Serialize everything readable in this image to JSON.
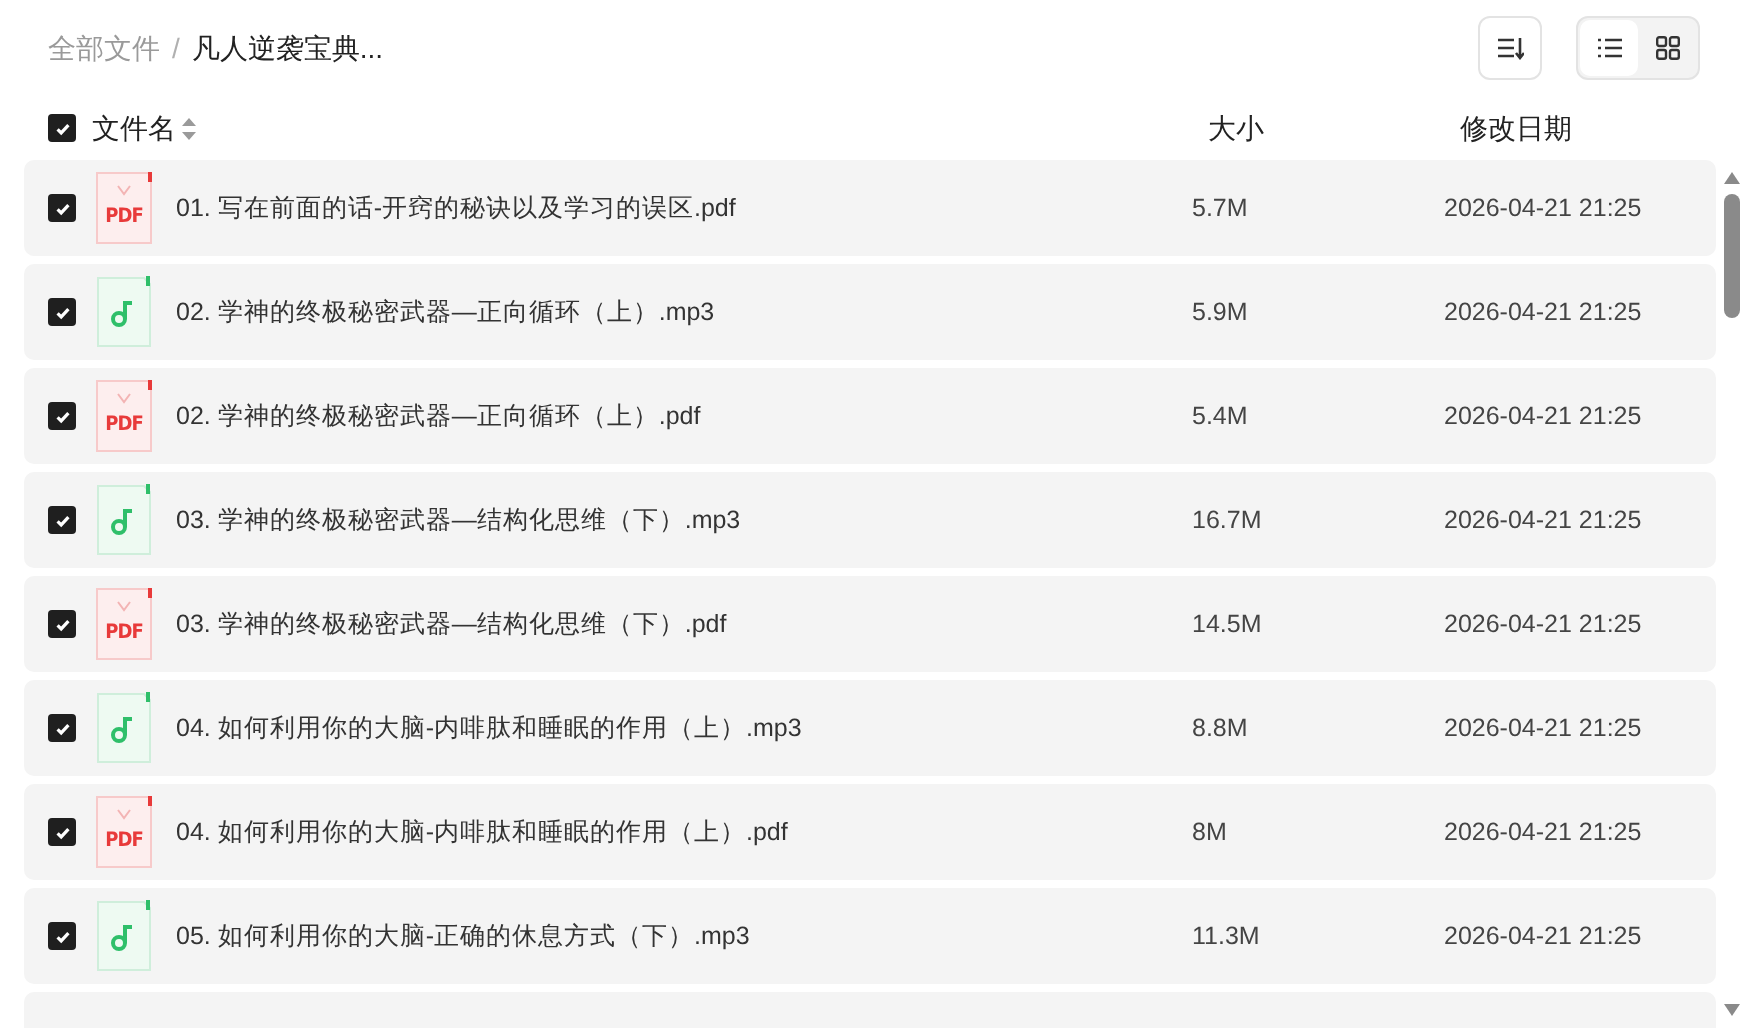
{
  "breadcrumb": {
    "root": "全部文件",
    "separator": "/",
    "current": "凡人逆袭宝典..."
  },
  "view_toggle": [
    {
      "kind": "list",
      "selected": true
    },
    {
      "kind": "grid",
      "selected": false
    }
  ],
  "header": {
    "checked": true,
    "name": "文件名",
    "size": "大小",
    "date": "修改日期"
  },
  "files": [
    {
      "kind": "pdf",
      "icon_label": "PDF",
      "checked": true,
      "name": "01. 写在前面的话-开窍的秘诀以及学习的误区.pdf",
      "size": "5.7M",
      "date": "2026-04-21 21:25"
    },
    {
      "kind": "audio",
      "checked": true,
      "name": "02. 学神的终极秘密武器—正向循环（上）.mp3",
      "size": "5.9M",
      "date": "2026-04-21 21:25"
    },
    {
      "kind": "pdf",
      "icon_label": "PDF",
      "checked": true,
      "name": "02. 学神的终极秘密武器—正向循环（上）.pdf",
      "size": "5.4M",
      "date": "2026-04-21 21:25"
    },
    {
      "kind": "audio",
      "checked": true,
      "name": "03. 学神的终极秘密武器—结构化思维（下）.mp3",
      "size": "16.7M",
      "date": "2026-04-21 21:25"
    },
    {
      "kind": "pdf",
      "icon_label": "PDF",
      "checked": true,
      "name": "03. 学神的终极秘密武器—结构化思维（下）.pdf",
      "size": "14.5M",
      "date": "2026-04-21 21:25"
    },
    {
      "kind": "audio",
      "checked": true,
      "name": "04. 如何利用你的大脑-内啡肽和睡眠的作用（上）.mp3",
      "size": "8.8M",
      "date": "2026-04-21 21:25"
    },
    {
      "kind": "pdf",
      "icon_label": "PDF",
      "checked": true,
      "name": "04. 如何利用你的大脑-内啡肽和睡眠的作用（上）.pdf",
      "size": "8M",
      "date": "2026-04-21 21:25"
    },
    {
      "kind": "audio",
      "checked": true,
      "name": "05. 如何利用你的大脑-正确的休息方式（下）.mp3",
      "size": "11.3M",
      "date": "2026-04-21 21:25"
    }
  ]
}
